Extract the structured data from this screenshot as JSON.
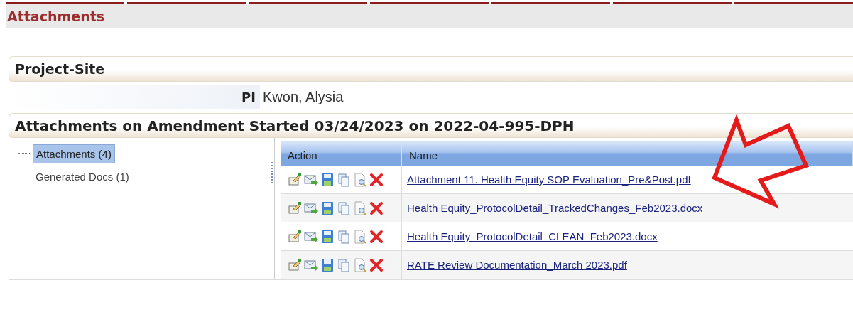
{
  "page_title": "Attachments",
  "section_title": "Project-Site",
  "pi": {
    "label": "PI",
    "value": "Kwon, Alysia"
  },
  "attachments_title": "Attachments on Amendment Started 03/24/2023 on 2022-04-995-DPH",
  "tree": [
    {
      "label": "Attachments (4)",
      "selected": true
    },
    {
      "label": "Generated Docs (1)",
      "selected": false
    }
  ],
  "grid": {
    "columns": [
      "Action",
      "Name"
    ],
    "rows": [
      {
        "name": "Attachment 11. Health Equity SOP Evaluation_Pre&Post.pdf"
      },
      {
        "name": "Health Equity_ProtocolDetail_TrackedChanges_Feb2023.docx"
      },
      {
        "name": "Health Equity_ProtocolDetail_CLEAN_Feb2023.docx"
      },
      {
        "name": "RATE Review Documentation_March 2023.pdf"
      }
    ]
  }
}
